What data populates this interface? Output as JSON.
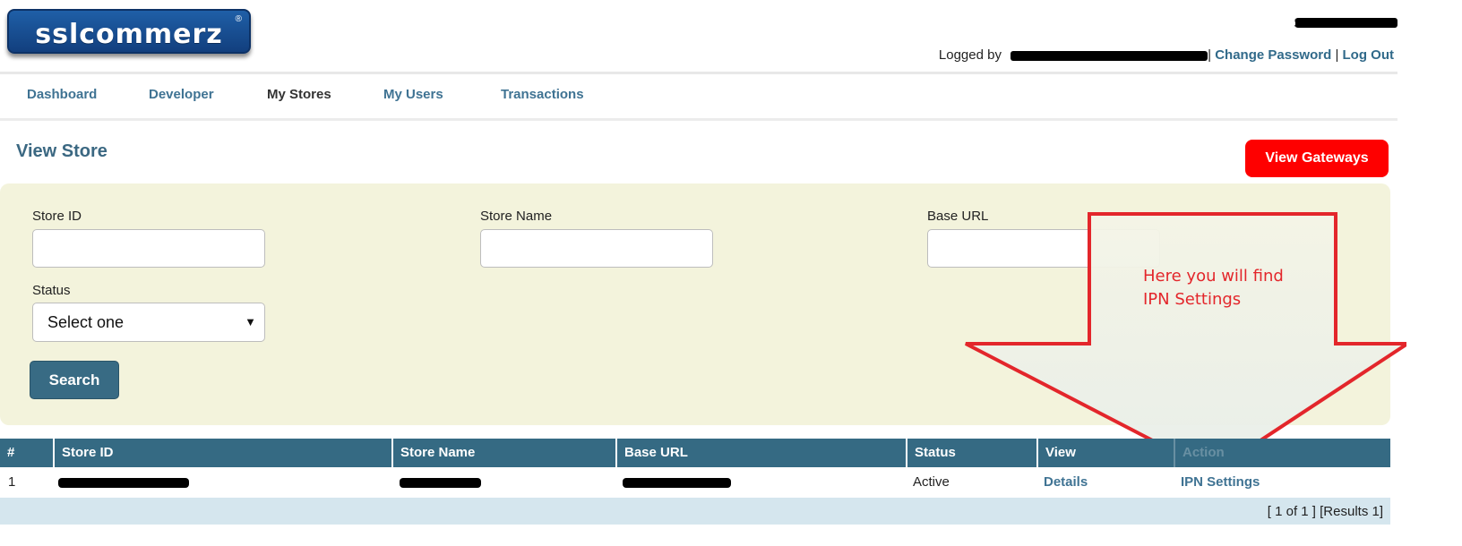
{
  "header": {
    "logo_text": "sslcommerz",
    "brand_label": "SSLCOMMERZ",
    "logged_by_label": "Logged by",
    "separator": "|",
    "change_password": "Change Password",
    "log_out": "Log Out"
  },
  "nav": {
    "items": [
      {
        "label": "Dashboard",
        "active": false
      },
      {
        "label": "Developer",
        "active": false
      },
      {
        "label": "My Stores",
        "active": true
      },
      {
        "label": "My Users",
        "active": false
      },
      {
        "label": "Transactions",
        "active": false
      }
    ]
  },
  "page": {
    "title": "View Store",
    "view_gateways": "View Gateways"
  },
  "filter": {
    "store_id_label": "Store ID",
    "store_id_value": "",
    "store_name_label": "Store Name",
    "store_name_value": "",
    "base_url_label": "Base URL",
    "base_url_value": "",
    "status_label": "Status",
    "status_selected": "Select one",
    "search_button": "Search"
  },
  "annotation": {
    "line1": "Here you will find",
    "line2": "IPN Settings",
    "color": "#e3262b"
  },
  "table": {
    "columns": [
      "#",
      "Store ID",
      "Store Name",
      "Base URL",
      "Status",
      "View",
      "Action"
    ],
    "rows": [
      {
        "index": "1",
        "status": "Active",
        "view": "Details",
        "action": "IPN Settings"
      }
    ],
    "pager": "[ 1   of   1 ] [Results 1]"
  },
  "colors": {
    "header_row": "#356a83",
    "filter_bg": "#f3f3dc",
    "gateway_button": "#fe0000",
    "link": "#3f7393",
    "pager_bg": "#d5e6ee"
  }
}
